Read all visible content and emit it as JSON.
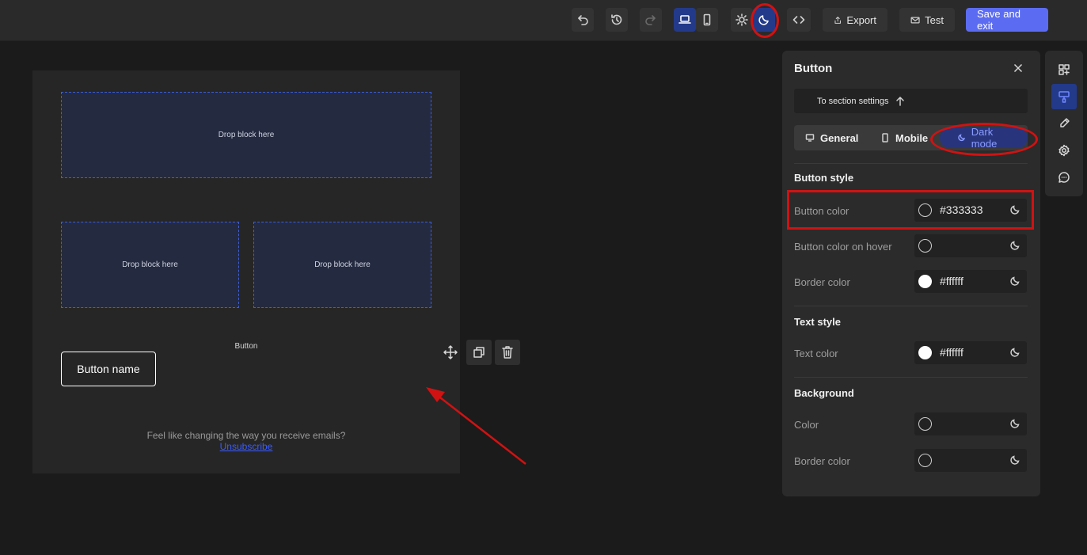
{
  "toolbar": {
    "icons": [
      "undo-icon",
      "history-icon",
      "redo-icon",
      "desktop-icon",
      "mobile-icon",
      "sun-icon",
      "moon-icon",
      "code-icon"
    ],
    "export_label": "Export",
    "test_label": "Test",
    "save_label": "Save and exit",
    "accent_color": "#5b6cf2"
  },
  "canvas": {
    "drop_label_1": "Drop block here",
    "drop_label_2": "Drop block here",
    "drop_label_3": "Drop block here",
    "button_block_label": "Button",
    "button_text": "Button name",
    "footer_text": "Feel like changing the way you receive emails?",
    "unsubscribe_text": "Unsubscribe",
    "block_tool_icons": [
      "move-icon",
      "duplicate-icon",
      "trash-icon"
    ]
  },
  "panel": {
    "title": "Button",
    "to_section": "To section settings",
    "tabs": [
      {
        "label": "General",
        "icon": "desktop-icon"
      },
      {
        "label": "Mobile",
        "icon": "mobile-icon"
      },
      {
        "label": "Dark mode",
        "icon": "moon-icon",
        "active": true
      }
    ],
    "button_style": {
      "heading": "Button style",
      "button_color_label": "Button color",
      "button_color_value": "#333333",
      "hover_label": "Button color on hover",
      "hover_value": "",
      "border_label": "Border color",
      "border_value": "#ffffff"
    },
    "text_style": {
      "heading": "Text style",
      "text_color_label": "Text color",
      "text_color_value": "#ffffff"
    },
    "background": {
      "heading": "Background",
      "color_label": "Color",
      "color_value": "",
      "border_label": "Border color",
      "border_value": ""
    }
  },
  "rail": {
    "icons": [
      "blocks-icon",
      "paint-icon",
      "brush-icon",
      "settings-icon",
      "comment-icon"
    ],
    "active": "paint-icon"
  },
  "annotations": {
    "highlight_color": "#d11212"
  }
}
